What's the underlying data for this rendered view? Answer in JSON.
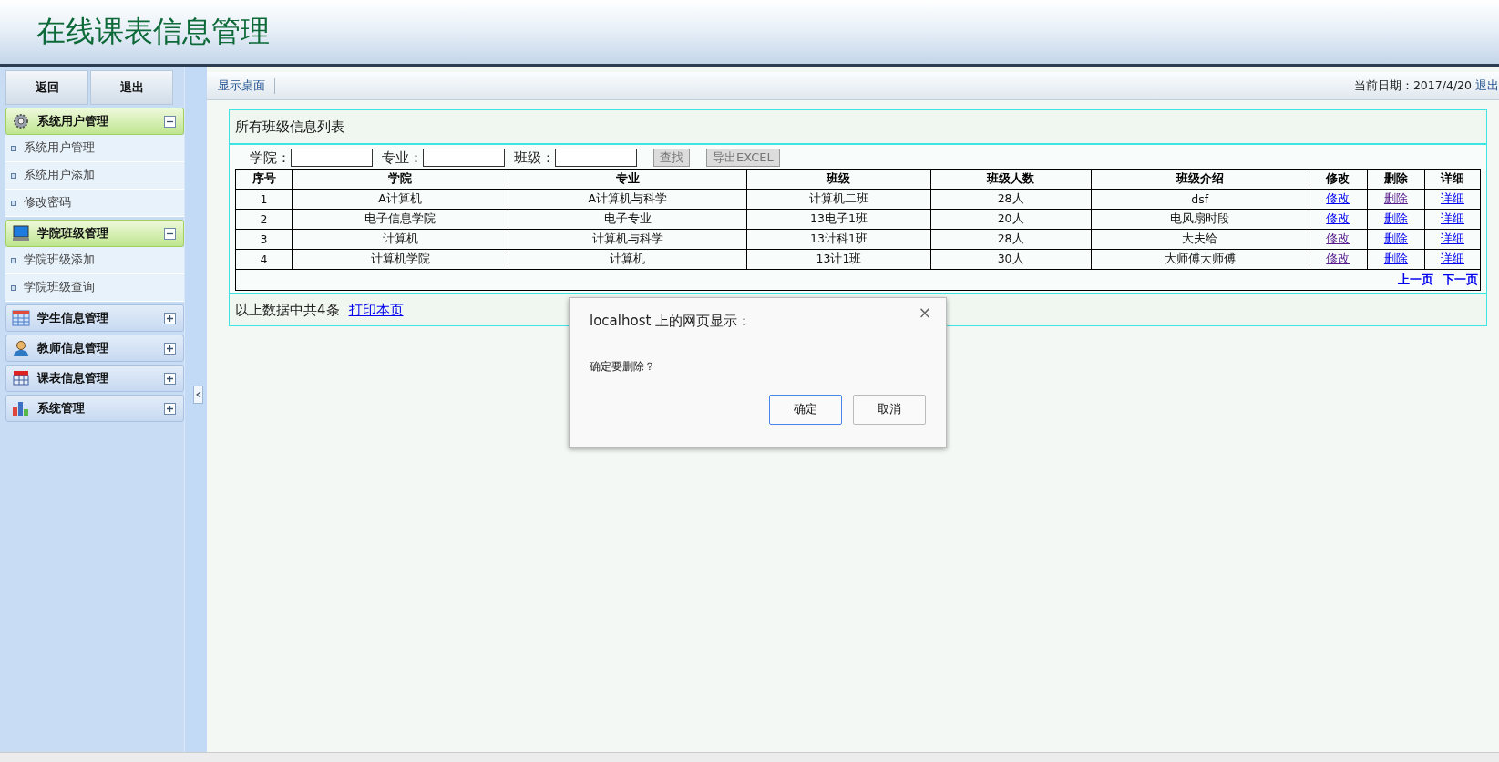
{
  "header": {
    "title": "在线课表信息管理"
  },
  "sidebar": {
    "buttons": [
      "返回",
      "退出"
    ],
    "groups": [
      {
        "label": "系统用户管理",
        "kind": "gear",
        "expanded": true,
        "children": [
          {
            "label": "系统用户管理"
          },
          {
            "label": "系统用户添加"
          },
          {
            "label": "修改密码"
          }
        ]
      },
      {
        "label": "学院班级管理",
        "kind": "monitor",
        "expanded": true,
        "children": [
          {
            "label": "学院班级添加"
          },
          {
            "label": "学院班级查询"
          }
        ]
      },
      {
        "label": "学生信息管理",
        "kind": "grid",
        "expanded": false
      },
      {
        "label": "教师信息管理",
        "kind": "person",
        "expanded": false
      },
      {
        "label": "课表信息管理",
        "kind": "calendar",
        "expanded": false
      },
      {
        "label": "系统管理",
        "kind": "chart",
        "expanded": false
      }
    ]
  },
  "toolbar": {
    "links": [
      "显示桌面"
    ],
    "date": "当前日期：2017/4/20",
    "logout": "退出"
  },
  "panel": {
    "title": "所有班级信息列表",
    "filters": [
      {
        "label": "学院："
      },
      {
        "label": "专业："
      },
      {
        "label": "班级："
      }
    ],
    "buttons": [
      "查找",
      "导出EXCEL"
    ],
    "columns": [
      "序号",
      "学院",
      "专业",
      "班级",
      "班级人数",
      "班级介绍",
      "修改",
      "删除",
      "详细"
    ],
    "rows": [
      {
        "cells": [
          "1",
          "A计算机",
          "A计算机与科学",
          "计算机二班",
          "28人",
          "dsf"
        ],
        "links": [
          {
            "text": "修改",
            "visited": false
          },
          {
            "text": "删除",
            "visited": true
          },
          {
            "text": "详细",
            "visited": false
          }
        ]
      },
      {
        "cells": [
          "2",
          "电子信息学院",
          "电子专业",
          "13电子1班",
          "20人",
          "电风扇时段"
        ],
        "links": [
          {
            "text": "修改",
            "visited": false
          },
          {
            "text": "删除",
            "visited": false
          },
          {
            "text": "详细",
            "visited": false
          }
        ]
      },
      {
        "cells": [
          "3",
          "计算机",
          "计算机与科学",
          "13计科1班",
          "28人",
          "大夫给"
        ],
        "links": [
          {
            "text": "修改",
            "visited": true
          },
          {
            "text": "删除",
            "visited": false
          },
          {
            "text": "详细",
            "visited": false
          }
        ]
      },
      {
        "cells": [
          "4",
          "计算机学院",
          "计算机",
          "13计1班",
          "30人",
          "大师傅大师傅"
        ],
        "links": [
          {
            "text": "修改",
            "visited": true
          },
          {
            "text": "删除",
            "visited": false
          },
          {
            "text": "详细",
            "visited": false
          }
        ]
      }
    ],
    "pager": [
      "上一页",
      "下一页"
    ],
    "summary": "以上数据中共4条",
    "print_link": "打印本页"
  },
  "dialog": {
    "title": "localhost 上的网页显示：",
    "close": "×",
    "message": "确定要删除？",
    "buttons": [
      {
        "label": "确定",
        "focused": true
      },
      {
        "label": "取消",
        "focused": false
      }
    ]
  }
}
